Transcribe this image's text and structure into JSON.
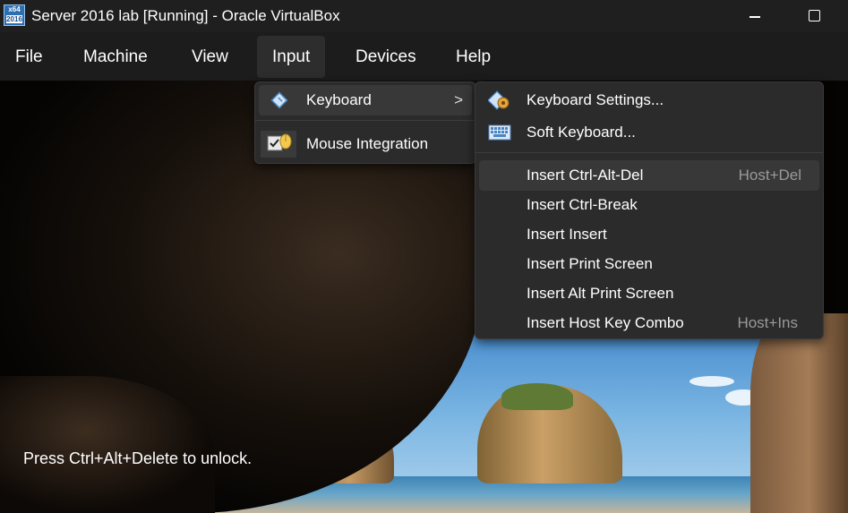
{
  "window": {
    "title": "Server 2016 lab [Running] - Oracle VirtualBox",
    "icon_top": "x64",
    "icon_bottom": "2016"
  },
  "menubar": {
    "items": [
      "File",
      "Machine",
      "View",
      "Input",
      "Devices",
      "Help"
    ],
    "active": "Input"
  },
  "input_menu": {
    "items": [
      {
        "label": "Keyboard",
        "icon": "keyboard-diamond-icon",
        "has_submenu": true
      },
      {
        "label": "Mouse Integration",
        "icon": "mouse-integration-icon"
      }
    ]
  },
  "keyboard_menu": {
    "items": [
      {
        "label": "Keyboard Settings...",
        "icon": "keyboard-settings-icon"
      },
      {
        "label": "Soft Keyboard...",
        "icon": "soft-keyboard-icon"
      },
      {
        "label": "Insert Ctrl-Alt-Del",
        "shortcut": "Host+Del"
      },
      {
        "label": "Insert Ctrl-Break"
      },
      {
        "label": "Insert Insert"
      },
      {
        "label": "Insert Print Screen"
      },
      {
        "label": "Insert Alt Print Screen"
      },
      {
        "label": "Insert Host Key Combo",
        "shortcut": "Host+Ins"
      }
    ]
  },
  "vm_screen": {
    "lock_message": "Press Ctrl+Alt+Delete to unlock."
  },
  "colors": {
    "menu_bg": "#2b2b2b",
    "titlebar_bg": "#1f1f1f",
    "highlight": "#383838"
  }
}
